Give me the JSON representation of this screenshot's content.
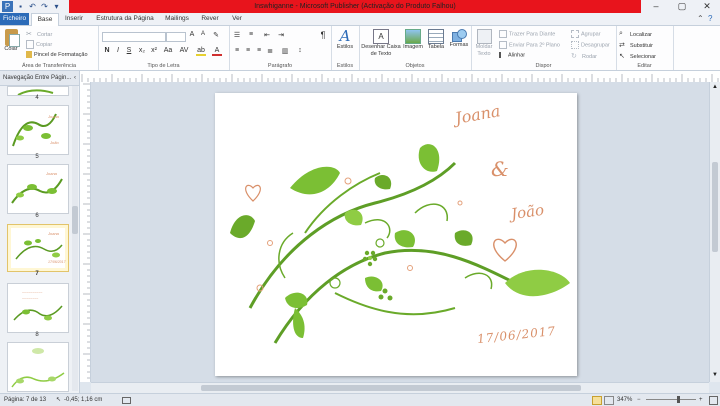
{
  "window": {
    "title": "Inswhiganne - Microsoft Publisher (Activação do Produto Falhou)"
  },
  "tabs": [
    "Ficheiro",
    "Base",
    "Inserir",
    "Estrutura da Página",
    "Mailings",
    "Rever",
    "Ver"
  ],
  "ribbon": {
    "clipboard": {
      "paste": "Colar",
      "cut": "Cortar",
      "copy": "Copiar",
      "format_painter": "Pincel de Formatação",
      "label": "Área de Transferência"
    },
    "font": {
      "bold": "N",
      "italic": "I",
      "underline": "S",
      "subscript": "x₂",
      "superscript": "x²",
      "label": "Tipo de Letra"
    },
    "paragraph": {
      "label": "Parágrafo"
    },
    "styles": {
      "button": "Estilos",
      "label": "Estilos"
    },
    "objects": {
      "draw_textbox": "Desenhar Caixa de Texto",
      "picture": "Imagem",
      "table": "Tabela",
      "shapes": "Formas",
      "label": "Objetos"
    },
    "arrange": {
      "wrap_text": "Moldar Texto",
      "bring_forward": "Trazer Para Diante",
      "send_backward": "Enviar Para 2º Plano",
      "align": "Alinhar",
      "group": "Agrupar",
      "ungroup": "Desagrupar",
      "rotate": "Rodar",
      "label": "Dispor"
    },
    "editing": {
      "find": "Localizar",
      "replace": "Substituir",
      "select": "Selecionar",
      "label": "Editar"
    }
  },
  "nav": {
    "title": "Navegação Entre Págin...",
    "pages": [
      {
        "number": "4"
      },
      {
        "number": "5"
      },
      {
        "number": "6"
      },
      {
        "number": "7",
        "selected": true
      },
      {
        "number": "8"
      },
      {
        "number": ""
      }
    ]
  },
  "page": {
    "name1": "Joana",
    "ampersand": "&",
    "name2": "João",
    "date": "17/06/2017"
  },
  "status": {
    "page": "Página: 7 de 13",
    "position": "-0,45; 1,16 cm",
    "zoom": "347%"
  },
  "colors": {
    "title_band": "#e8141c",
    "file_tab": "#2c6bb8",
    "leaf_green": "#6aaa2a",
    "script_orange": "#d9906a",
    "selected_thumb": "#fff7d4"
  }
}
